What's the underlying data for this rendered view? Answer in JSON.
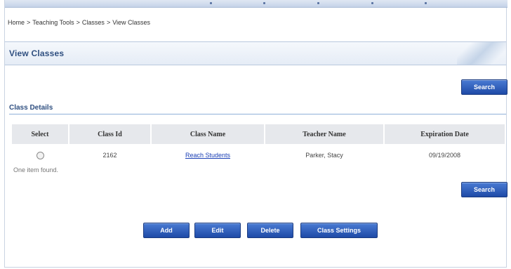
{
  "breadcrumb": {
    "items": [
      "Home",
      "Teaching Tools",
      "Classes",
      "View Classes"
    ],
    "separator": ">"
  },
  "page": {
    "title": "View Classes"
  },
  "buttons": {
    "search_top": "Search",
    "search_bottom": "Search",
    "add": "Add",
    "edit": "Edit",
    "delete": "Delete",
    "class_settings": "Class Settings"
  },
  "section": {
    "title": "Class Details"
  },
  "table": {
    "headers": [
      "Select",
      "Class Id",
      "Class Name",
      "Teacher Name",
      "Expiration Date"
    ],
    "rows": [
      {
        "class_id": "2162",
        "class_name": "Reach Students",
        "teacher": "Parker, Stacy",
        "expiration": "09/19/2008"
      }
    ]
  },
  "status": {
    "found_text": "One item found."
  },
  "colors": {
    "accent": "#2f4f80",
    "button": "#1e4aa7",
    "link": "#1a3fb5",
    "header_bg": "#e6e8ec"
  }
}
